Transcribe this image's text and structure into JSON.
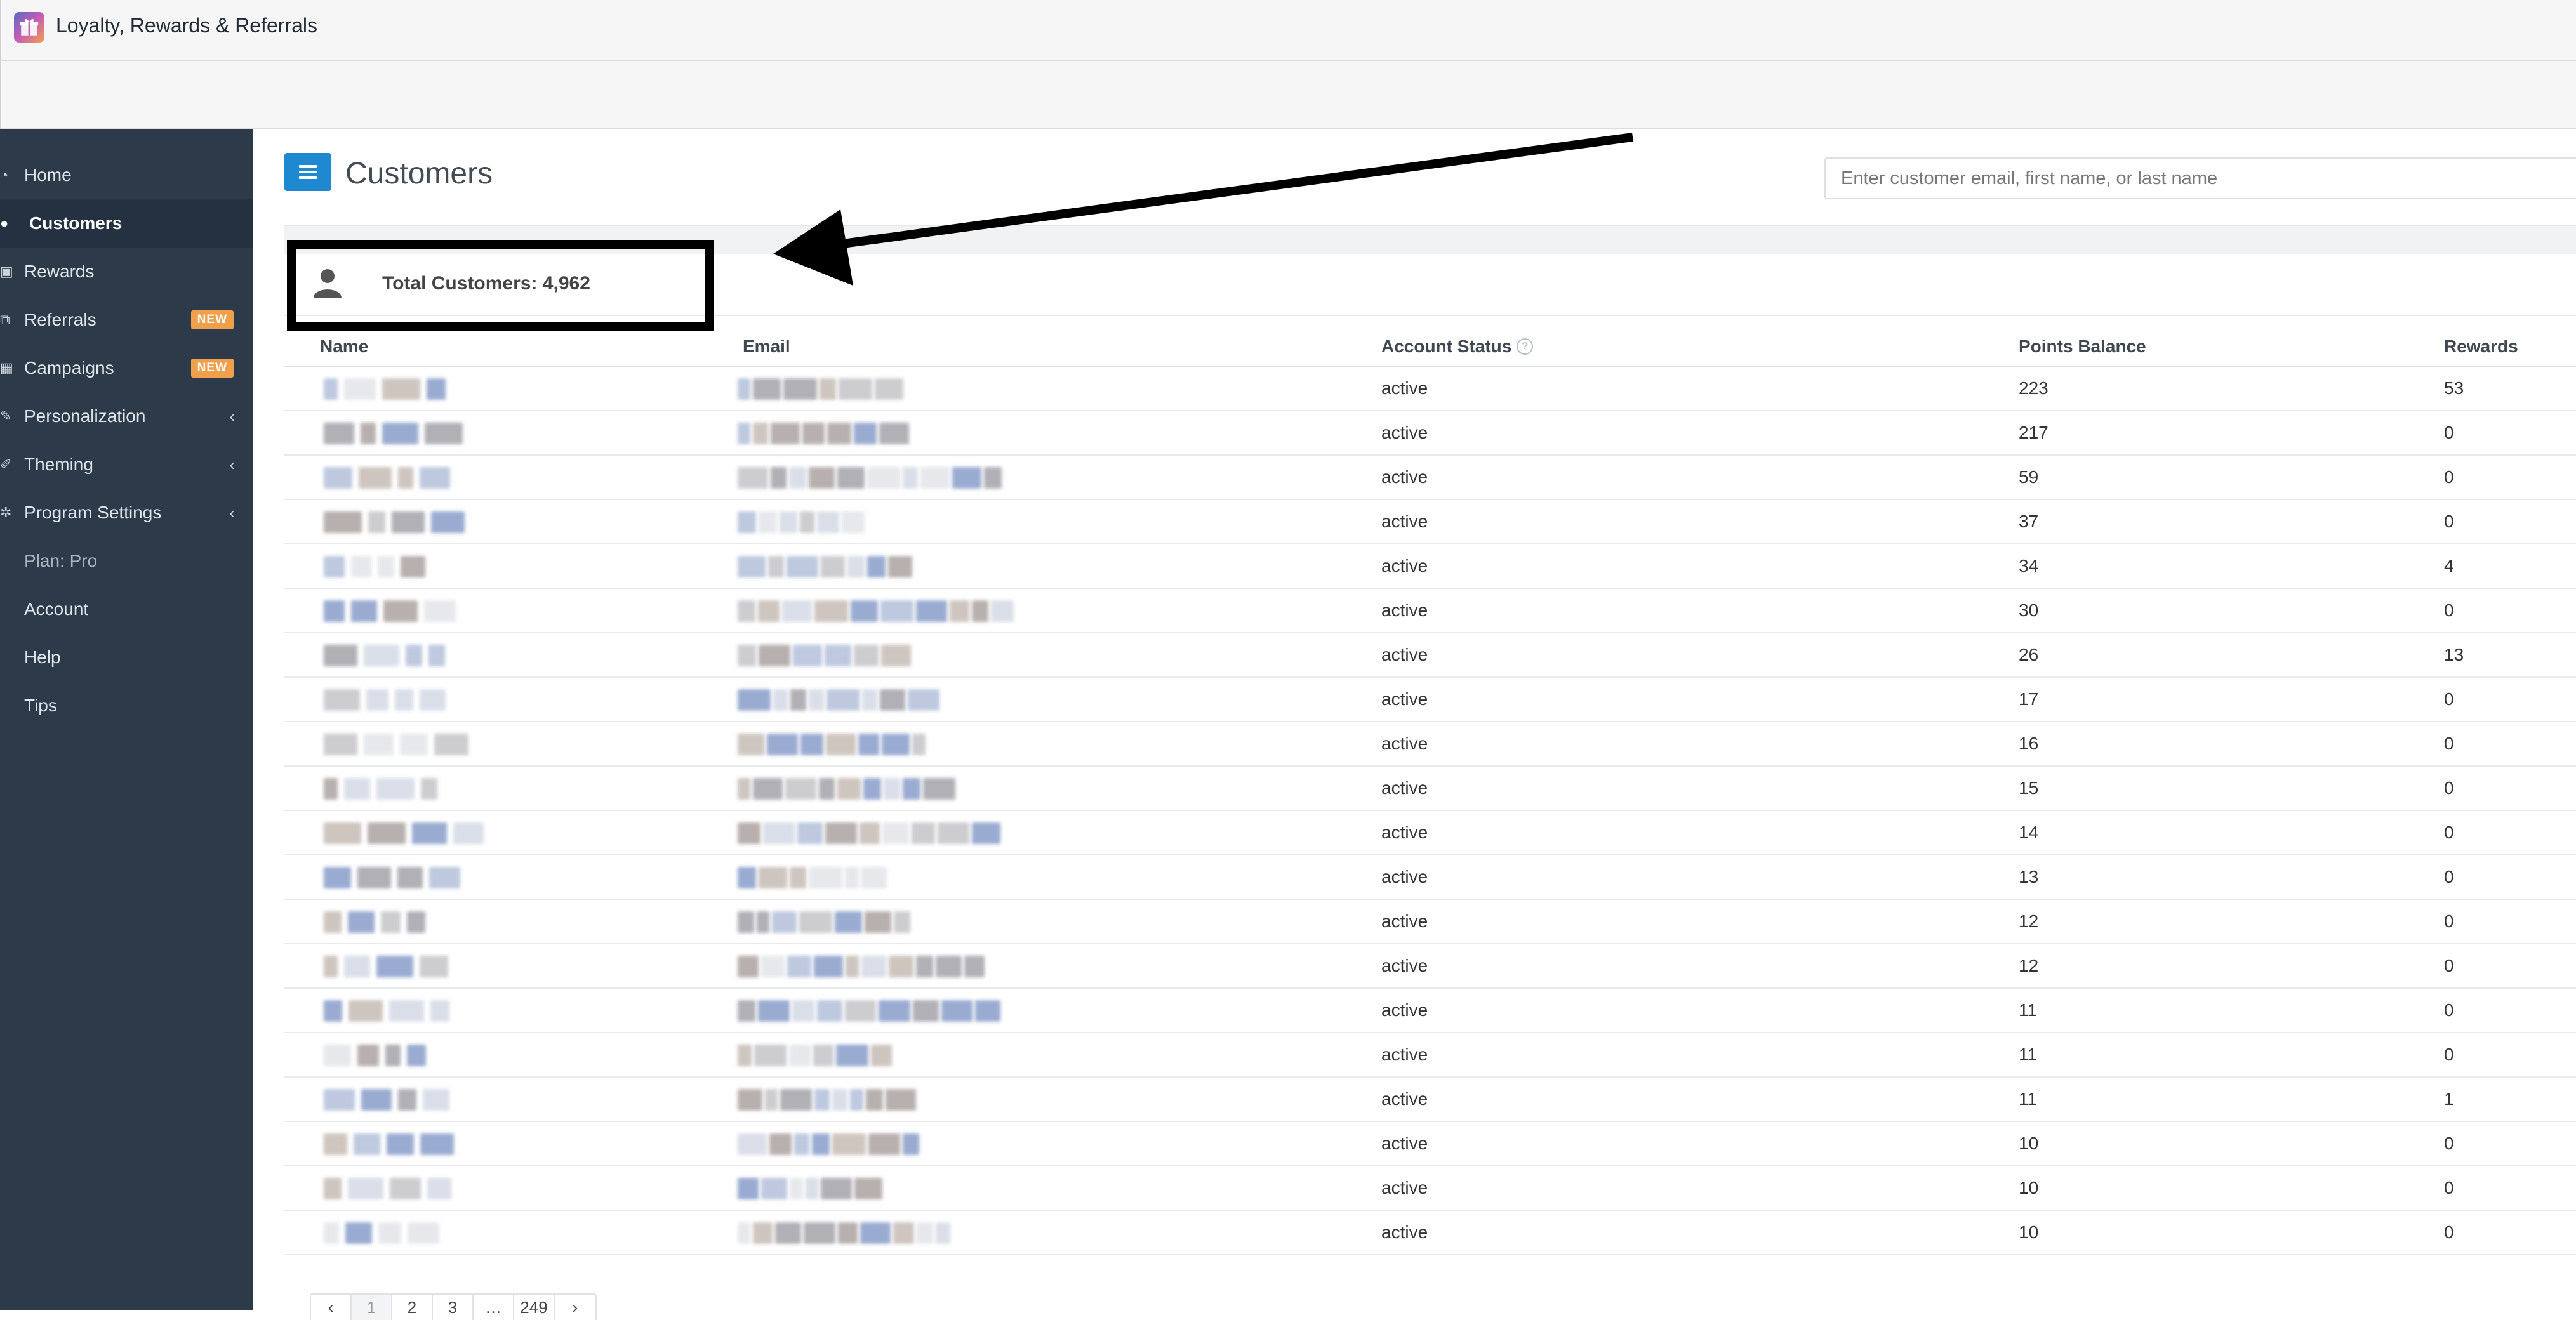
{
  "app": {
    "title": "Loyalty, Rewards & Referrals",
    "logo_icon": "gift-icon"
  },
  "sidebar": {
    "items": [
      {
        "label": "Home",
        "icon": "dashboard-icon"
      },
      {
        "label": "Customers",
        "icon": "user-icon",
        "active": true
      },
      {
        "label": "Rewards",
        "icon": "gift-icon"
      },
      {
        "label": "Referrals",
        "icon": "share-icon",
        "badge": "NEW"
      },
      {
        "label": "Campaigns",
        "icon": "calendar-icon",
        "badge": "NEW"
      },
      {
        "label": "Personalization",
        "icon": "edit-icon",
        "chevron": "‹"
      },
      {
        "label": "Theming",
        "icon": "brush-icon",
        "chevron": "‹"
      },
      {
        "label": "Program Settings",
        "icon": "gear-icon",
        "chevron": "‹"
      },
      {
        "label": "Plan: Pro"
      },
      {
        "label": "Account"
      },
      {
        "label": "Help"
      },
      {
        "label": "Tips"
      }
    ]
  },
  "page": {
    "title": "Customers",
    "search_placeholder": "Enter customer email, first name, or last name",
    "total_customers": "Total Customers: 4,962"
  },
  "table": {
    "headers": {
      "name": "Name",
      "email": "Email",
      "status": "Account Status",
      "points": "Points Balance",
      "rewards": "Rewards"
    },
    "rows": [
      {
        "status": "active",
        "points": "223",
        "rewards": "53"
      },
      {
        "status": "active",
        "points": "217",
        "rewards": "0"
      },
      {
        "status": "active",
        "points": "59",
        "rewards": "0"
      },
      {
        "status": "active",
        "points": "37",
        "rewards": "0"
      },
      {
        "status": "active",
        "points": "34",
        "rewards": "4"
      },
      {
        "status": "active",
        "points": "30",
        "rewards": "0"
      },
      {
        "status": "active",
        "points": "26",
        "rewards": "13"
      },
      {
        "status": "active",
        "points": "17",
        "rewards": "0"
      },
      {
        "status": "active",
        "points": "16",
        "rewards": "0"
      },
      {
        "status": "active",
        "points": "15",
        "rewards": "0"
      },
      {
        "status": "active",
        "points": "14",
        "rewards": "0"
      },
      {
        "status": "active",
        "points": "13",
        "rewards": "0"
      },
      {
        "status": "active",
        "points": "12",
        "rewards": "0"
      },
      {
        "status": "active",
        "points": "12",
        "rewards": "0"
      },
      {
        "status": "active",
        "points": "11",
        "rewards": "0"
      },
      {
        "status": "active",
        "points": "11",
        "rewards": "0"
      },
      {
        "status": "active",
        "points": "11",
        "rewards": "1"
      },
      {
        "status": "active",
        "points": "10",
        "rewards": "0"
      },
      {
        "status": "active",
        "points": "10",
        "rewards": "0"
      },
      {
        "status": "active",
        "points": "10",
        "rewards": "0"
      }
    ]
  },
  "pagination": {
    "pages": [
      "‹",
      "1",
      "2",
      "3",
      "…",
      "249",
      "›"
    ],
    "current": "1"
  },
  "colors": {
    "sidebar_bg": "#2c3a4a",
    "accent": "#1e88d0",
    "badge": "#f0a04b",
    "annotation": "#000000"
  }
}
